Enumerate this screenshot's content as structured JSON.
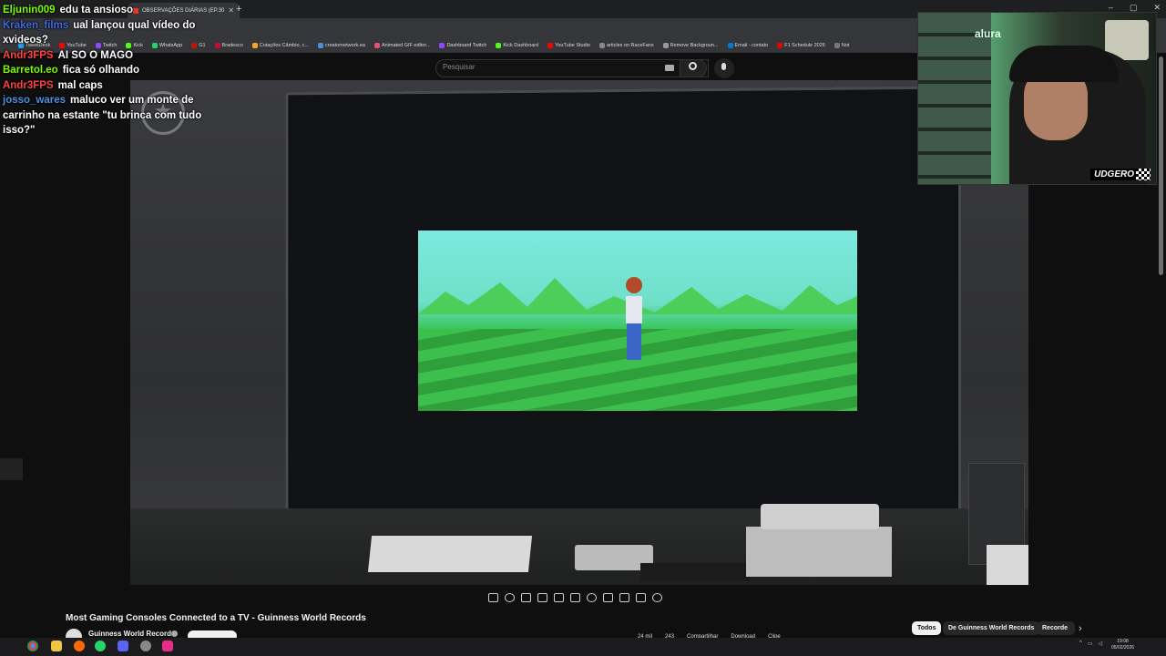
{
  "browser": {
    "tabs": [
      {
        "label": "OBSERVAÇÕES DIÁRIAS (EP.30",
        "active": true
      }
    ],
    "new_tab": "+",
    "bookmarks": [
      {
        "label": "TweetDeck",
        "color": "#1da1f2"
      },
      {
        "label": "YouTube",
        "color": "#ff0000"
      },
      {
        "label": "Twitch",
        "color": "#9146ff"
      },
      {
        "label": "Kick",
        "color": "#53fc18"
      },
      {
        "label": "WhatsApp",
        "color": "#25d366"
      },
      {
        "label": "G1",
        "color": "#c4170c"
      },
      {
        "label": "Bradesco",
        "color": "#cc092f"
      },
      {
        "label": "Cotações Câmbio, c...",
        "color": "#f5a623"
      },
      {
        "label": "creatornetwork.ea",
        "color": "#4a90e2"
      },
      {
        "label": "Animated GIF editor...",
        "color": "#e94e77"
      },
      {
        "label": "Dashboard Twitch",
        "color": "#9146ff"
      },
      {
        "label": "Kick Dashboard",
        "color": "#53fc18"
      },
      {
        "label": "YouTube Studio",
        "color": "#ff0000"
      },
      {
        "label": "articles on RaceFans",
        "color": "#888888"
      },
      {
        "label": "Remove Backgroun...",
        "color": "#999999"
      },
      {
        "label": "Email - contato",
        "color": "#0078d4"
      },
      {
        "label": "F1 Schedule 2026",
        "color": "#e10600"
      },
      {
        "label": "Not",
        "color": "#777777"
      }
    ]
  },
  "youtube": {
    "search_placeholder": "Pesquisar",
    "video_title": "Most Gaming Consoles Connected to a TV - Guinness World Records",
    "channel_name": "Guinness World Records",
    "chips": [
      "Todos",
      "De Guinness World Records",
      "Recorde"
    ],
    "actions": [
      "24 mil",
      "243",
      "Compartilhar",
      "Download",
      "Clipe"
    ]
  },
  "chat": [
    {
      "user": "Eljunin009",
      "color": "#7cfc00",
      "message": "edu ta ansioso"
    },
    {
      "user": "Kraken_films",
      "color": "#4169e1",
      "message": "ual lançou qual vídeo do xvideos?"
    },
    {
      "user": "Andr3FPS",
      "color": "#ff4040",
      "message": "AI SO O MAGO"
    },
    {
      "user": "Barretol.eo",
      "color": "#7cfc00",
      "message": "fica só olhando"
    },
    {
      "user": "Andr3FPS",
      "color": "#ff4040",
      "message": "mal caps"
    },
    {
      "user": "josso_wares",
      "color": "#4a90e2",
      "message": "maluco ver um monte de carrinho na estante \"tu brinca com tudo isso?\""
    }
  ],
  "webcam": {
    "sign": "alura",
    "logo": "UDGERO"
  },
  "taskbar": {
    "time": "19:08",
    "date": "05/02/2026"
  }
}
